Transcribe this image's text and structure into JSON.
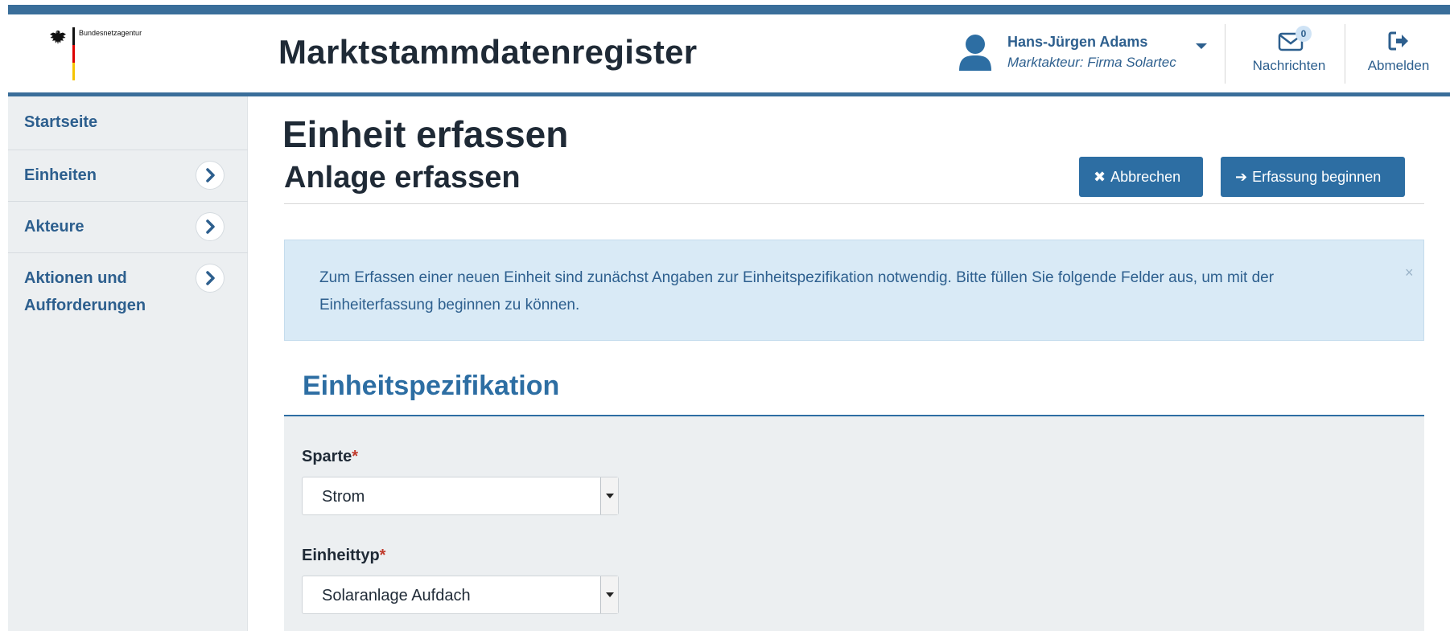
{
  "header": {
    "agency_name": "Bundesnetzagentur",
    "app_title": "Marktstammdatenregister",
    "user_name": "Hans-Jürgen Adams",
    "user_role": "Marktakteur: Firma Solartec",
    "messages_label": "Nachrichten",
    "messages_count": "0",
    "logout_label": "Abmelden"
  },
  "sidebar": {
    "items": [
      {
        "label": "Startseite"
      },
      {
        "label": "Einheiten"
      },
      {
        "label": "Akteure"
      },
      {
        "label": "Aktionen und",
        "label2": "Aufforderungen"
      }
    ]
  },
  "main": {
    "title": "Einheit erfassen",
    "subtitle": "Anlage erfassen",
    "cancel_label": "Abbrechen",
    "start_label": "Erfassung beginnen",
    "alert_text": "Zum Erfassen einer neuen Einheit sind zunächst Angaben zur Einheitspezifikation notwendig. Bitte füllen Sie folgende Felder aus, um mit der Einheiterfassung beginnen zu können.",
    "alert_close": "×",
    "section_title": "Einheitspezifikation",
    "fields": [
      {
        "label": "Sparte",
        "required_mark": "*",
        "value": "Strom"
      },
      {
        "label": "Einheittyp",
        "required_mark": "*",
        "value": "Solaranlage Aufdach"
      }
    ]
  },
  "colors": {
    "primary": "#2d6ea3",
    "header_bar": "#3a6e9a",
    "alert_bg": "#d9eaf6",
    "sidebar_bg": "#eceff1",
    "required": "#c0392b"
  },
  "icons": {
    "user": "user-icon",
    "messages": "envelope-icon",
    "logout": "sign-out-icon",
    "nav_arrow": "chevron-right-icon",
    "cancel": "times-icon",
    "start": "arrow-right-icon"
  }
}
